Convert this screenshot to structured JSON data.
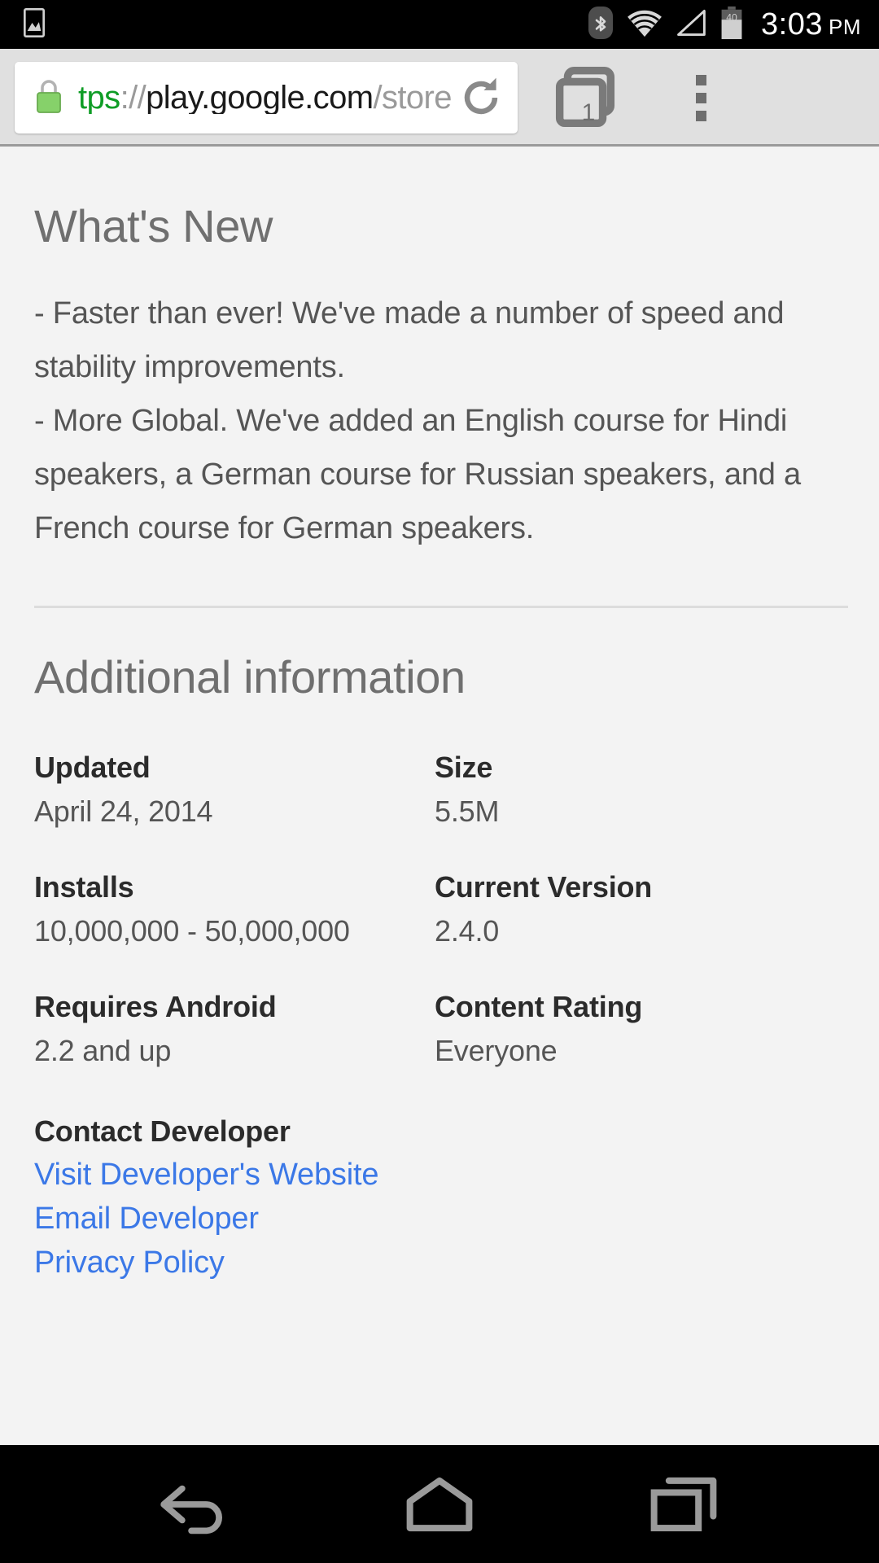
{
  "status_bar": {
    "icons": [
      "image-icon",
      "bluetooth-icon",
      "wifi-icon",
      "cellular-signal-icon",
      "battery-icon"
    ],
    "battery_level": "40",
    "time": "3:03",
    "ampm": "PM"
  },
  "browser": {
    "lock_icon": "lock-icon",
    "url": {
      "scheme": "tps",
      "separator": "://",
      "host": "play.google.com",
      "path": "/store/",
      "full": "tps://play.google.com/store/"
    },
    "reload_icon": "reload-icon",
    "tab_count": "1",
    "menu_icon": "overflow-menu-icon"
  },
  "page": {
    "whats_new": {
      "title": "What's New",
      "body": "- Faster than ever! We've made a number of speed and stability improvements.\n- More Global. We've added an English course for Hindi speakers, a German course for Russian speakers, and a French course for German speakers."
    },
    "additional_information": {
      "title": "Additional information",
      "fields": [
        {
          "label": "Updated",
          "value": "April 24, 2014"
        },
        {
          "label": "Size",
          "value": "5.5M"
        },
        {
          "label": "Installs",
          "value": "10,000,000 - 50,000,000"
        },
        {
          "label": "Current Version",
          "value": "2.4.0"
        },
        {
          "label": "Requires Android",
          "value": "2.2 and up"
        },
        {
          "label": "Content Rating",
          "value": "Everyone"
        }
      ]
    },
    "contact_developer": {
      "heading": "Contact Developer",
      "links": [
        "Visit Developer's Website",
        "Email Developer",
        "Privacy Policy"
      ]
    }
  },
  "nav_bar": {
    "back": "back-icon",
    "home": "home-icon",
    "recents": "recents-icon"
  },
  "colors": {
    "link": "#3b78e7",
    "scheme_green": "#0f9d26",
    "page_bg": "#f3f3f3",
    "chrome_bg": "#e0e0e0",
    "system_black": "#000000"
  }
}
